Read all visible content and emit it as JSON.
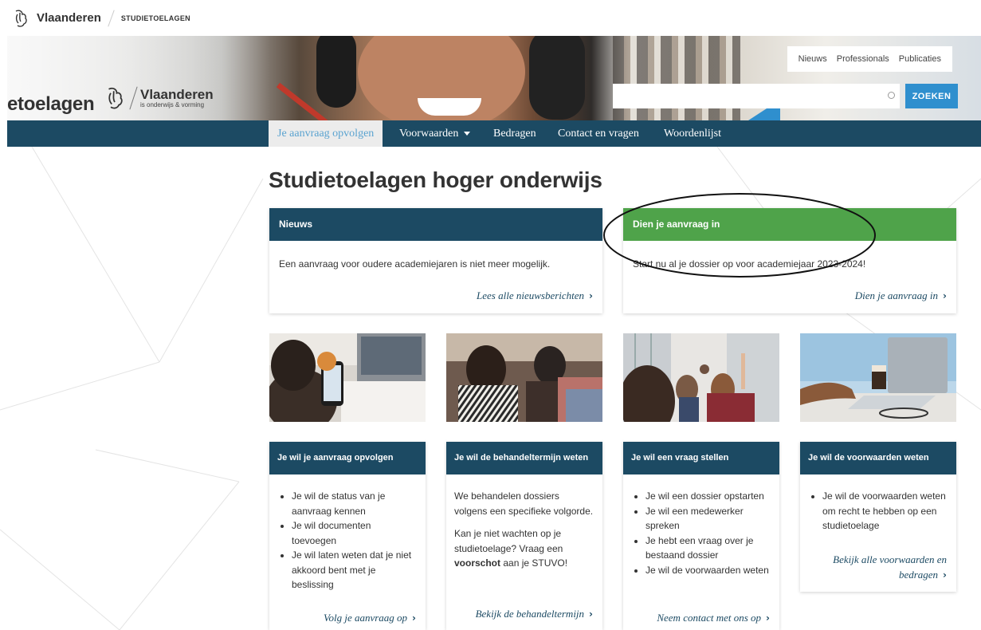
{
  "topbar": {
    "brand": "Vlaanderen",
    "sub": "STUDIETOELAGEN"
  },
  "hero": {
    "logo_text": "etoelagen",
    "logo_brand": "Vlaanderen",
    "logo_sub": "is onderwijs & vorming"
  },
  "quick_links": [
    "Nieuws",
    "Professionals",
    "Publicaties"
  ],
  "search": {
    "placeholder": "",
    "button": "ZOEKEN"
  },
  "nav": [
    {
      "label": "Je aanvraag opvolgen",
      "active": true
    },
    {
      "label": "Voorwaarden",
      "dropdown": true
    },
    {
      "label": "Bedragen"
    },
    {
      "label": "Contact en vragen"
    },
    {
      "label": "Woordenlijst"
    }
  ],
  "page_title": "Studietoelagen hoger onderwijs",
  "news_card": {
    "title": "Nieuws",
    "text": "Een aanvraag voor oudere academiejaren is niet meer mogelijk.",
    "link": "Lees alle nieuwsberichten"
  },
  "apply_card": {
    "title": "Dien je aanvraag in",
    "text": "Start nu al je dossier op voor academiejaar 2023-2024!",
    "link": "Dien je aanvraag in"
  },
  "cards": [
    {
      "title": "Je wil je aanvraag opvolgen",
      "items": [
        "Je wil de status van je aanvraag kennen",
        "Je wil documenten toevoegen",
        "Je wil laten weten dat je niet akkoord bent met je beslissing"
      ],
      "link": "Volg je aanvraag op"
    },
    {
      "title": "Je wil de behandeltermijn weten",
      "p1": "We behandelen dossiers volgens een specifieke volgorde.",
      "p2_pre": "Kan je niet wachten op je studietoelage? Vraag een ",
      "p2_bold": "voorschot",
      "p2_post": " aan je STUVO!",
      "link": "Bekijk de behandeltermijn"
    },
    {
      "title": "Je wil een vraag stellen",
      "items": [
        "Je wil een dossier opstarten",
        "Je wil een medewerker spreken",
        "Je hebt een vraag over je bestaand dossier",
        "Je wil de voorwaarden weten"
      ],
      "link": "Neem contact met ons op"
    },
    {
      "title": "Je wil de voorwaarden weten",
      "items": [
        "Je wil de voorwaarden weten om recht te hebben op een studietoelage"
      ],
      "link": "Bekijk alle voorwaarden en bedragen"
    }
  ],
  "colors": {
    "navy": "#1c4a63",
    "green": "#4fa34a",
    "blue": "#2f8fce"
  }
}
